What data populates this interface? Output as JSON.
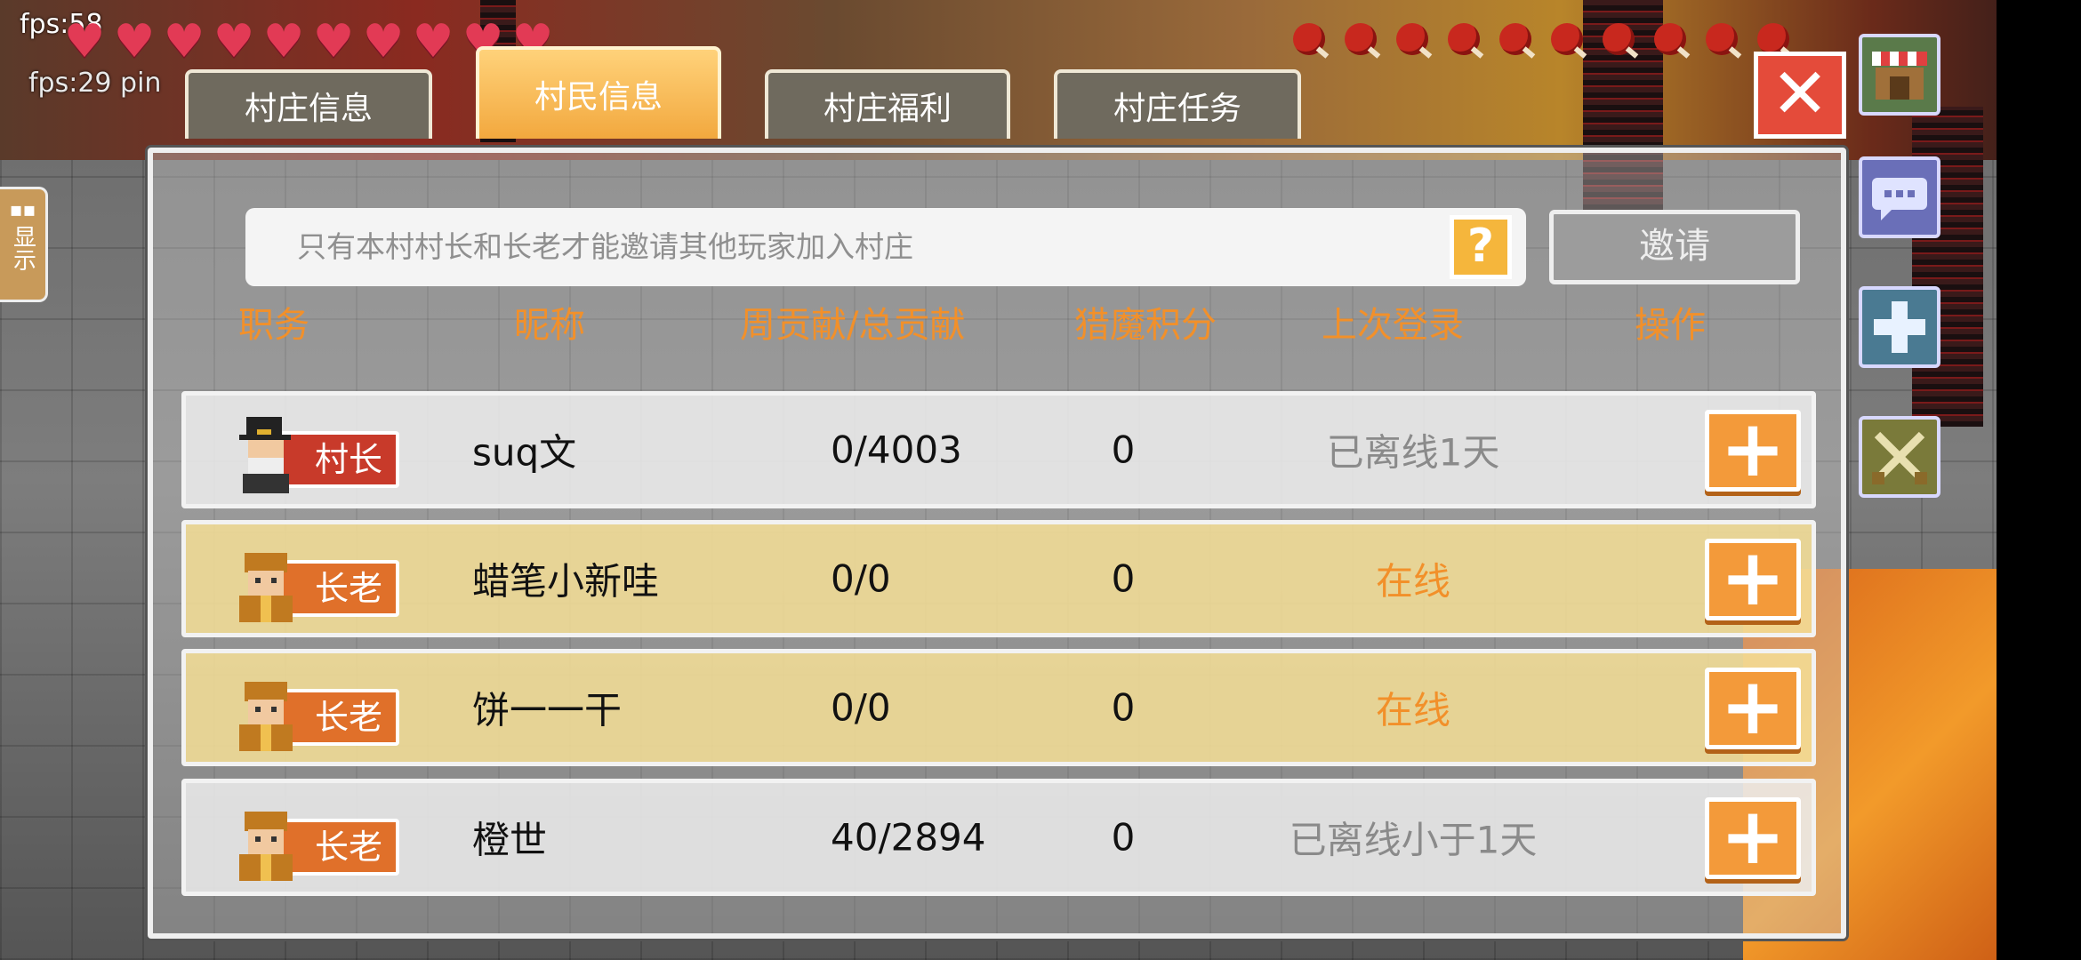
{
  "hud": {
    "fps_primary": "fps:58",
    "fps_secondary": "fps:29 pin",
    "hearts": 10,
    "hunger": 10
  },
  "tabs": [
    {
      "label": "村庄信息",
      "active": false
    },
    {
      "label": "村民信息",
      "active": true
    },
    {
      "label": "村庄福利",
      "active": false
    },
    {
      "label": "村庄任务",
      "active": false
    }
  ],
  "notice": {
    "text": "只有本村村长和长老才能邀请其他玩家加入村庄",
    "help_label": "?"
  },
  "invite_label": "邀请",
  "close_label": "✕",
  "left_tab_label": "显示",
  "table": {
    "headers": [
      "职务",
      "昵称",
      "周贡献/总贡献",
      "猎魔积分",
      "上次登录",
      "操作"
    ],
    "rows": [
      {
        "role": "村长",
        "name": "suq文",
        "contribution": "0/4003",
        "points": "0",
        "last_login": "已离线1天",
        "online": false,
        "action": "+"
      },
      {
        "role": "长老",
        "name": "蜡笔小新哇",
        "contribution": "0/0",
        "points": "0",
        "last_login": "在线",
        "online": true,
        "action": "+"
      },
      {
        "role": "长老",
        "name": "饼一一干",
        "contribution": "0/0",
        "points": "0",
        "last_login": "在线",
        "online": true,
        "action": "+"
      },
      {
        "role": "长老",
        "name": "橙世",
        "contribution": "40/2894",
        "points": "0",
        "last_login": "已离线小于1天",
        "online": false,
        "action": "+"
      }
    ]
  },
  "side_buttons": [
    "shop-icon",
    "chat-icon",
    "plus-icon",
    "crossed-swords-icon"
  ],
  "colors": {
    "header": "#f2902a",
    "online": "#f2902a",
    "offline": "#8a8a8a",
    "tab_active": "#f2a83e",
    "plus_button": "#f39a3a",
    "close_button": "#e44b3a"
  }
}
